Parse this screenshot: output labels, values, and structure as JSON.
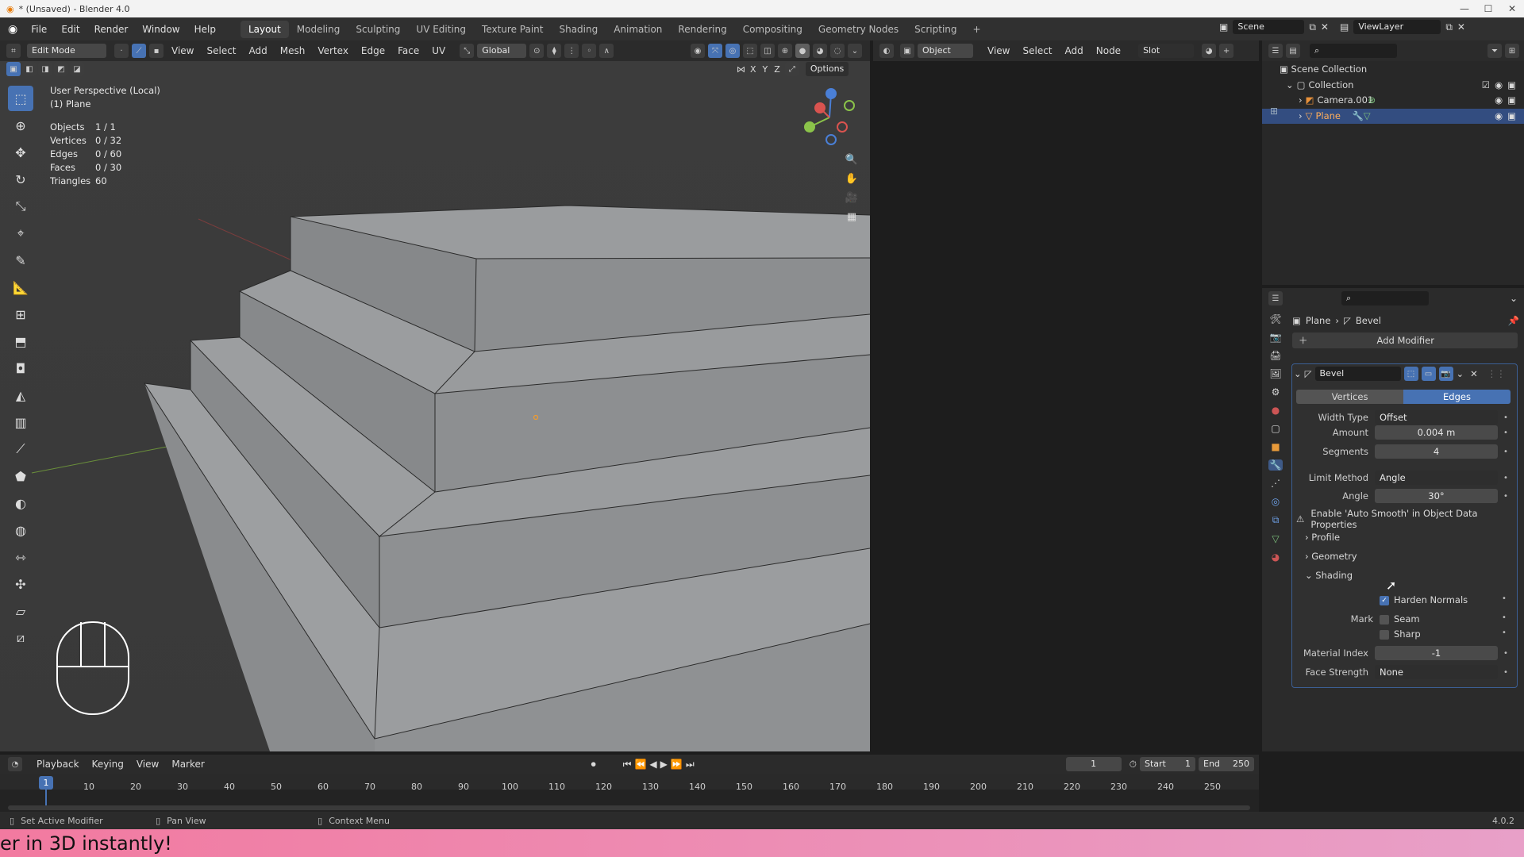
{
  "window": {
    "title": "* (Unsaved) - Blender 4.0",
    "controls": [
      "—",
      "☐",
      "✕"
    ]
  },
  "menus": [
    "File",
    "Edit",
    "Render",
    "Window",
    "Help"
  ],
  "workspaces": [
    "Layout",
    "Modeling",
    "Sculpting",
    "UV Editing",
    "Texture Paint",
    "Shading",
    "Animation",
    "Rendering",
    "Compositing",
    "Geometry Nodes",
    "Scripting"
  ],
  "topright": {
    "scene": "Scene",
    "viewlayer": "ViewLayer"
  },
  "viewport_header": {
    "mode": "Edit Mode",
    "menus": [
      "View",
      "Select",
      "Add",
      "Mesh",
      "Vertex",
      "Edge",
      "Face",
      "UV"
    ],
    "orientation": "Global",
    "axes": [
      "X",
      "Y",
      "Z"
    ],
    "options": "Options"
  },
  "viewport_info": {
    "perspective": "User Perspective (Local)",
    "object": "(1) Plane",
    "stats": [
      {
        "label": "Objects",
        "value": "1 / 1"
      },
      {
        "label": "Vertices",
        "value": "0 / 32"
      },
      {
        "label": "Edges",
        "value": "0 / 60"
      },
      {
        "label": "Faces",
        "value": "0 / 30"
      },
      {
        "label": "Triangles",
        "value": "60"
      }
    ]
  },
  "node_header": {
    "type": "Object",
    "menus": [
      "View",
      "Select",
      "Add",
      "Node"
    ],
    "slot": "Slot"
  },
  "outliner": {
    "root": "Scene Collection",
    "collection": "Collection",
    "items": [
      "Camera.001",
      "Plane"
    ]
  },
  "properties": {
    "breadcrumb": [
      "Plane",
      "Bevel"
    ],
    "add_modifier": "Add Modifier",
    "modifier_name": "Bevel",
    "tabs": [
      "Vertices",
      "Edges"
    ],
    "width_type": {
      "label": "Width Type",
      "value": "Offset"
    },
    "amount": {
      "label": "Amount",
      "value": "0.004 m"
    },
    "segments": {
      "label": "Segments",
      "value": "4"
    },
    "limit_method": {
      "label": "Limit Method",
      "value": "Angle"
    },
    "angle": {
      "label": "Angle",
      "value": "30°"
    },
    "warning": "Enable 'Auto Smooth' in Object Data Properties",
    "sections": [
      "Profile",
      "Geometry",
      "Shading"
    ],
    "harden_normals": "Harden Normals",
    "mark": {
      "label": "Mark",
      "seam": "Seam",
      "sharp": "Sharp"
    },
    "material_index": {
      "label": "Material Index",
      "value": "-1"
    },
    "face_strength": {
      "label": "Face Strength",
      "value": "None"
    }
  },
  "timeline": {
    "menus": [
      "Playback",
      "Keying",
      "View",
      "Marker"
    ],
    "current_frame": "1",
    "start_label": "Start",
    "start": "1",
    "end_label": "End",
    "end": "250",
    "ticks": [
      "1",
      "10",
      "20",
      "30",
      "40",
      "50",
      "60",
      "70",
      "80",
      "90",
      "100",
      "110",
      "120",
      "130",
      "140",
      "150",
      "160",
      "170",
      "180",
      "190",
      "200",
      "210",
      "220",
      "230",
      "240",
      "250"
    ]
  },
  "statusbar": {
    "items": [
      "Set Active Modifier",
      "Pan View",
      "Context Menu"
    ],
    "version": "4.0.2"
  },
  "banner": {
    "text": "er in 3D instantly!"
  }
}
